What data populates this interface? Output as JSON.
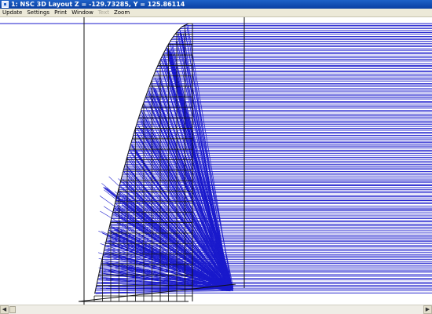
{
  "window": {
    "title": "1: NSC 3D Layout Z = -129.73285, Y = 125.86114"
  },
  "menu": [
    {
      "label": "Update",
      "enabled": true
    },
    {
      "label": "Settings",
      "enabled": true
    },
    {
      "label": "Print",
      "enabled": true
    },
    {
      "label": "Window",
      "enabled": true
    },
    {
      "label": "Text",
      "enabled": false
    },
    {
      "label": "Zoom",
      "enabled": true
    }
  ],
  "icons": {
    "app": "nsc-app-icon",
    "scroll_left": "left-arrow-icon",
    "scroll_right": "right-arrow-icon"
  },
  "colors": {
    "ray": "#1a1acc",
    "wireframe": "#111111",
    "background": "#ffffff",
    "titlebar": "#0a3fa2"
  }
}
